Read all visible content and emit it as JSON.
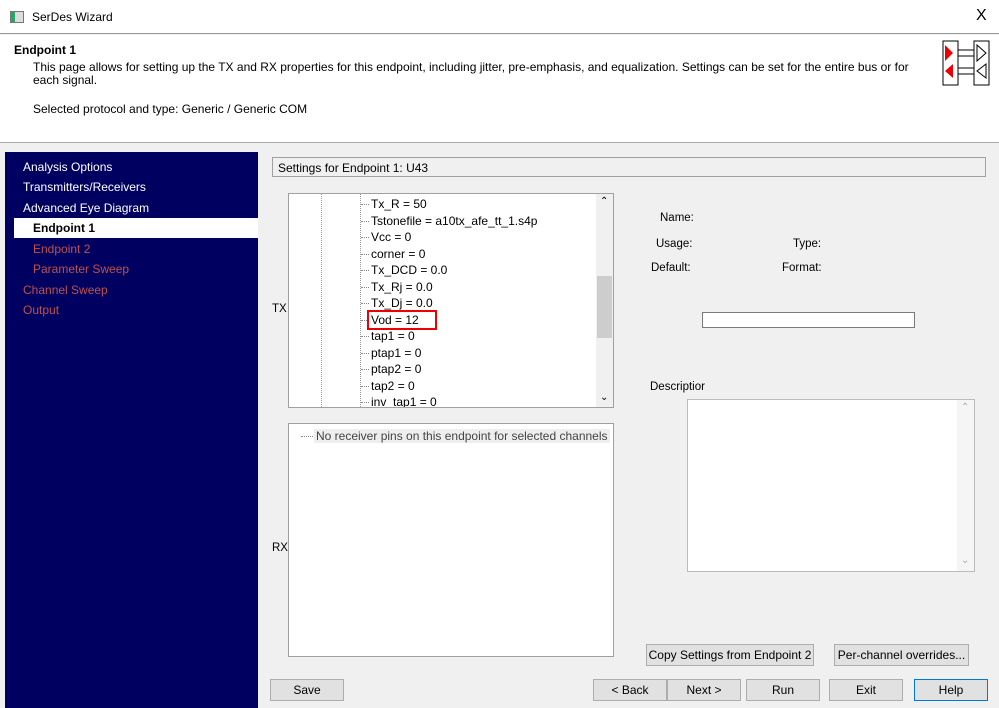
{
  "window": {
    "title": "SerDes Wizard",
    "close": "X"
  },
  "header": {
    "title": "Endpoint 1",
    "description": "This page allows for setting up the TX and RX properties for this endpoint, including jitter, pre-emphasis, and equalization.  Settings can be set for the entire bus or for each signal.",
    "protocol": "Selected protocol and type: Generic / Generic COM"
  },
  "sidebar": {
    "items": [
      {
        "label": "Analysis Options"
      },
      {
        "label": "Transmitters/Receivers"
      },
      {
        "label": "Advanced Eye Diagram"
      },
      {
        "label": "Endpoint 1"
      },
      {
        "label": "Endpoint 2"
      },
      {
        "label": "Parameter Sweep"
      },
      {
        "label": "Channel Sweep"
      },
      {
        "label": "Output"
      }
    ]
  },
  "main": {
    "settings_title": "Settings for Endpoint 1: U43",
    "tx_label": "TX",
    "rx_label": "RX",
    "tx_items": [
      "Tx_R = 50",
      "Tstonefile = a10tx_afe_tt_1.s4p",
      "Vcc = 0",
      "corner = 0",
      "Tx_DCD = 0.0",
      "Tx_Rj = 0.0",
      "Tx_Dj = 0.0",
      "Vod = 12",
      "tap1 = 0",
      "ptap1 = 0",
      "ptap2 = 0",
      "tap2 = 0",
      "inv_tap1 = 0"
    ],
    "rx_message": "No receiver pins on this endpoint for selected channels",
    "props": {
      "name": "Name:",
      "usage": "Usage:",
      "type": "Type:",
      "default": "Default:",
      "format": "Format:",
      "value": "",
      "description": "Descriptior"
    },
    "copy_button": "Copy Settings from Endpoint 2",
    "overrides_button": "Per-channel overrides..."
  },
  "footer": {
    "save": "Save",
    "back": "< Back",
    "next": "Next >",
    "run": "Run",
    "exit": "Exit",
    "help": "Help"
  }
}
